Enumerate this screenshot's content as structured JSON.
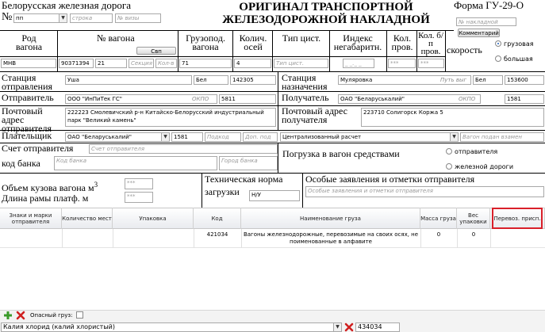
{
  "header": {
    "railway_name": "Белорусская железная дорога",
    "doc_title_line1": "ОРИГИНАЛ ТРАНСПОРТНОЙ",
    "doc_title_line2": "ЖЕЛЕЗОДОРОЖНОЙ НАКЛАДНОЙ",
    "form_code": "Форма ГУ-29-О",
    "number_sign": "№",
    "number_value": "пп",
    "row_placeholder": "строка",
    "visa_placeholder": "№ визы",
    "waybill_placeholder": "№ накладной",
    "comment_button": "Комментарий",
    "speed_label": "скорость",
    "speed_options": [
      "грузовая",
      "большая"
    ]
  },
  "wagon_table": {
    "headers": {
      "kind": "Род вагона",
      "number": "№ вагона",
      "capacity": "Грузопод. вагона",
      "axles": "Колич. осей",
      "cistern_type": "Тип цист.",
      "unload_index": "Индекс негабаритн.",
      "kol_prov": "Кол. пров.",
      "kol_bp": "Кол. б/п пров."
    },
    "svp_button": "Свп",
    "row": {
      "kind": "МНВ",
      "number": "90371394",
      "extra": "21",
      "section_placeholder": "Секция",
      "count_placeholder": "Кол-в",
      "capacity": "71",
      "axles": "4",
      "cistern_placeholder": "Тип цист.",
      "unload_value": "_ _._ _",
      "kol_prov": "***",
      "kol_bp": "***"
    }
  },
  "departure": {
    "label": "Станция отправления",
    "station": "Уша",
    "railway": "Бел",
    "code": "142305"
  },
  "destination": {
    "label": "Станция назначения",
    "station": "Муляровка",
    "route_placeholder": "Путь выг",
    "railway": "Бел",
    "code": "153600"
  },
  "sender": {
    "label": "Отправитель",
    "name": "ООО \"ИнПиТек ГС\"",
    "okpo_label": "ОКПО",
    "code": "5811"
  },
  "receiver": {
    "label": "Получатель",
    "name": "ОАО \"Беларуськалий\"",
    "okpo_label": "ОКПО",
    "code": "1581"
  },
  "sender_address": {
    "label": "Почтовый адрес отправителя",
    "value": "222223 Смолевичский р-н Китайско-Белорусский индустриальный парк \"Великий камень\""
  },
  "receiver_address": {
    "label": "Почтовый адрес получателя",
    "value": "223710 Солигорск Коржа 5"
  },
  "payer": {
    "label": "Плательщик",
    "name": "ОАО \"Беларуськалий\"",
    "code": "1581",
    "code_placeholder": "Подкод",
    "extra_placeholder": "Доп. под",
    "calc_type": "Централизованный расчет",
    "fee_placeholder": "Вагон подан взамен"
  },
  "sender_account": {
    "label": "Счет отправителя",
    "placeholder": "Счет отправителя",
    "bank_code_label": "код банка",
    "bank_placeholder": "Код банка",
    "city_placeholder": "Город банка"
  },
  "loading": {
    "label": "Погрузка в вагон средствами",
    "options": [
      "отправителя",
      "железной дороги"
    ]
  },
  "volume": {
    "label": "Объем кузова вагона м",
    "sup": "3",
    "value": "***"
  },
  "platform": {
    "label": "Длина рамы платф. м",
    "value": "***"
  },
  "tech_norm": {
    "label_line1": "Техническая норма",
    "label_line2": "загрузки",
    "value": "Н/У"
  },
  "special": {
    "label": "Особые заявления и отметки отправителя",
    "placeholder": "Особые заявления и отметки отправителя"
  },
  "cargo_table": {
    "columns": [
      "Знаки и марки отправителя",
      "Количество мест",
      "Упаковка",
      "Код",
      "Наименование груза",
      "Масса груза",
      "Вес упаковки",
      "Перевоз. присп."
    ],
    "rows": [
      {
        "marks": "",
        "places": "",
        "packing": "",
        "code": "421034",
        "name": "Вагоны железнодорожные, перевозимые на своих осях, не поименованные в алфавите",
        "mass": "0",
        "pack_weight": "0",
        "carrier": ""
      }
    ]
  },
  "toolbar": {
    "dangerous_label": "Опасный груз:",
    "cargo_select": "Калия хлорид (калий хлористый)",
    "cargo_code": "434034"
  },
  "colors": {
    "highlight_border": "#d9202a",
    "add_icon": "#3a9a2a",
    "delete_icon": "#d02020"
  }
}
